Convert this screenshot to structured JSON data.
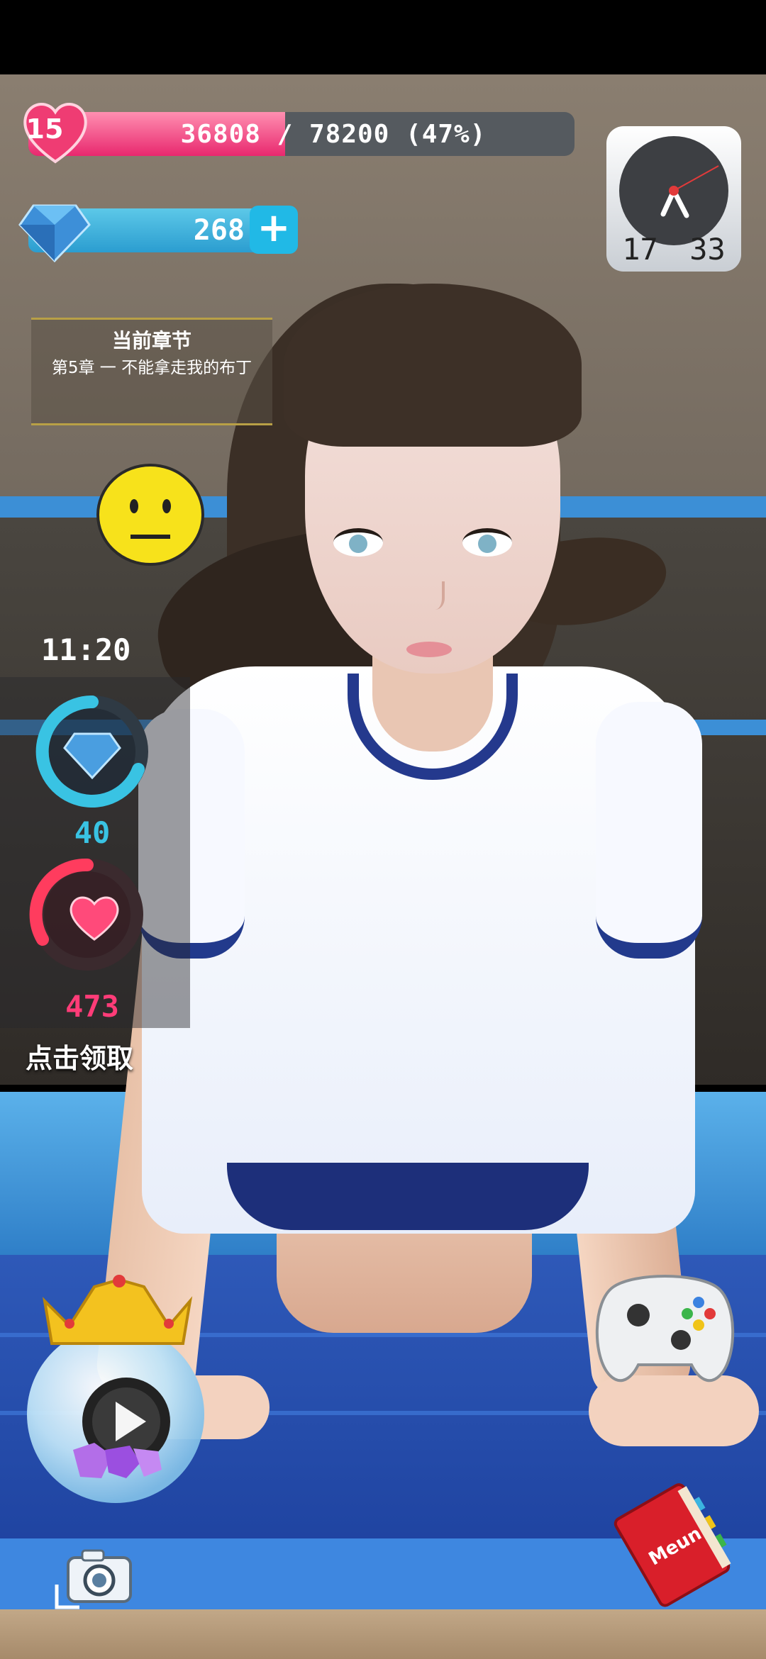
{
  "player": {
    "level": "15",
    "xp_text": "36808 / 78200 (47%)",
    "xp_progress": 0.47
  },
  "currency": {
    "gems": "268",
    "add_label": "+"
  },
  "clock": {
    "hour": "17",
    "minute": "33"
  },
  "chapter": {
    "title": "当前章节",
    "description": "第5章 一 不能拿走我的布丁"
  },
  "mood": {
    "icon": "neutral-face-emoji"
  },
  "rewards": {
    "timer": "11:20",
    "gem_reward": "40",
    "heart_reward": "473",
    "claim_label": "点击领取"
  },
  "buttons": {
    "menu_label": "Meun"
  },
  "colors": {
    "xp_fill": "#e8286e",
    "gem_bar": "#2b9dd0",
    "gem_reward_text": "#39c3e3",
    "heart_reward_text": "#ff3c78",
    "chapter_border": "#b8a046"
  }
}
